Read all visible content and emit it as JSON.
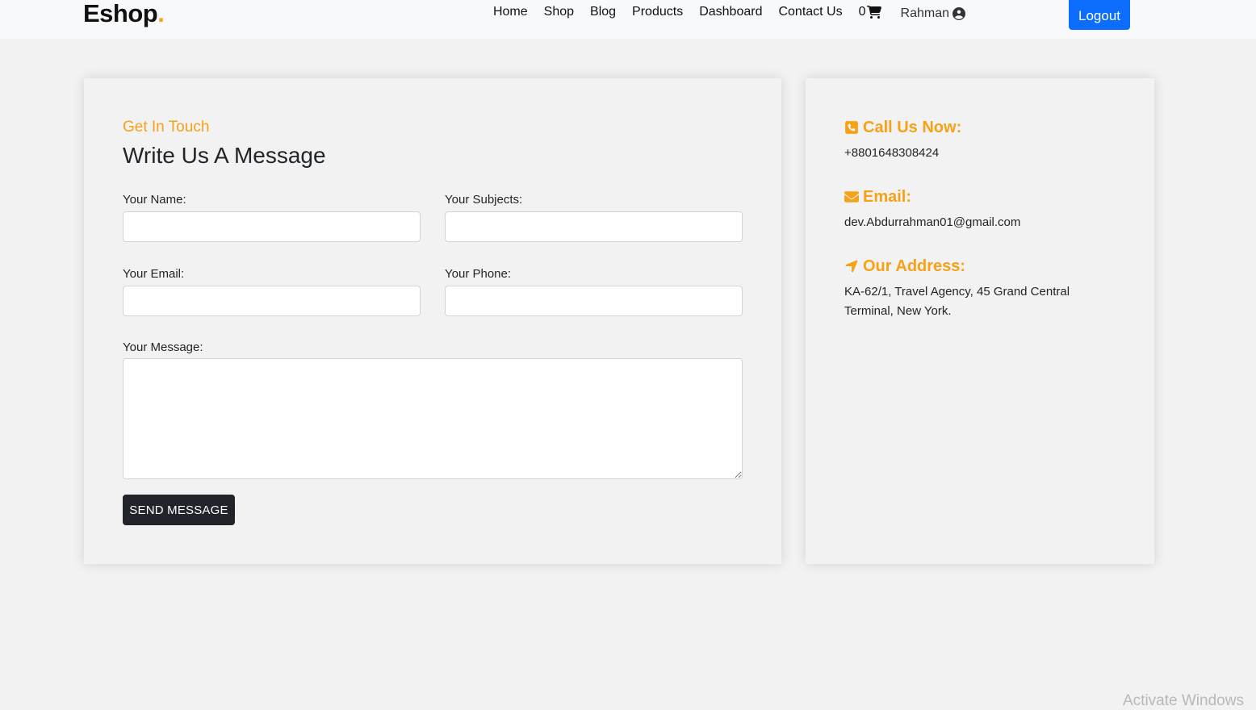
{
  "brand": {
    "name": "Eshop",
    "dot": ".",
    "accent": "#f6a116"
  },
  "nav": {
    "links": [
      "Home",
      "Shop",
      "Blog",
      "Products",
      "Dashboard",
      "Contact Us"
    ],
    "cart_count": "0",
    "user_name": "Rahman",
    "logout_label": "Logout"
  },
  "form": {
    "eyebrow": "Get In Touch",
    "heading": "Write Us A Message",
    "name_label": "Your Name:",
    "subjects_label": "Your Subjects:",
    "email_label": "Your Email:",
    "phone_label": "Your Phone:",
    "message_label": "Your Message:",
    "name_value": "",
    "subjects_value": "",
    "email_value": "",
    "phone_value": "",
    "message_value": "",
    "send_label": "SEND MESSAGE"
  },
  "contact": {
    "call_title": "Call Us Now:",
    "call_value": "+8801648308424",
    "email_title": "Email:",
    "email_value": "dev.Abdurrahman01@gmail.com",
    "address_title": "Our Address:",
    "address_value": "KA-62/1, Travel Agency, 45 Grand Central Terminal, New York."
  },
  "watermark": "Activate Windows",
  "colors": {
    "accent": "#f6a116",
    "primary": "#0d6efd",
    "dark": "#212529"
  }
}
